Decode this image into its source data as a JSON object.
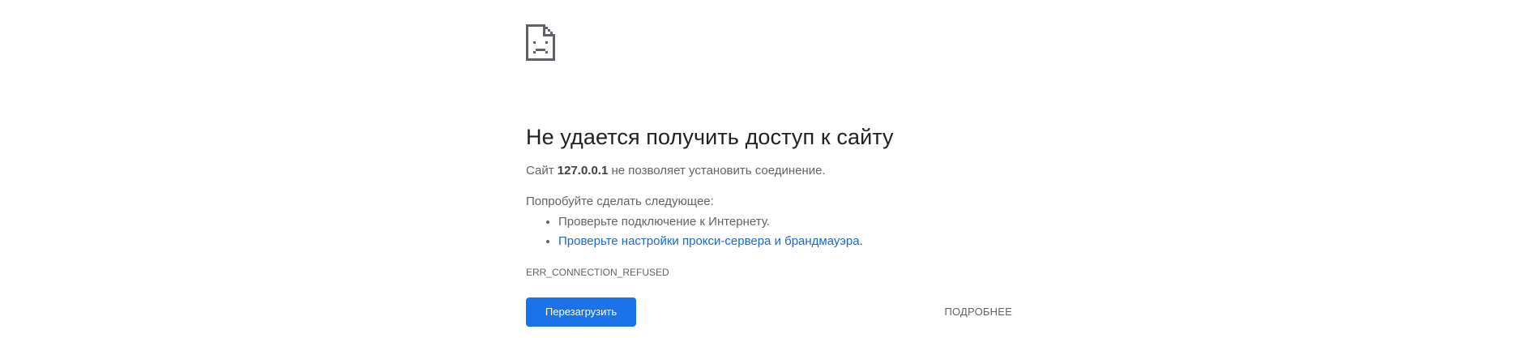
{
  "error_page": {
    "icon": "sad-page-icon",
    "title": "Не удается получить доступ к сайту",
    "summary_prefix": "Сайт ",
    "host": "127.0.0.1",
    "summary_suffix": " не позволяет установить соединение.",
    "suggestions_heading": "Попробуйте сделать следующее:",
    "suggestions": [
      {
        "label": "Проверьте подключение к Интернету.",
        "is_link": false
      },
      {
        "label": "Проверьте настройки прокси-сервера и брандмауэра.",
        "is_link": true
      }
    ],
    "error_code": "ERR_CONNECTION_REFUSED"
  },
  "buttons": {
    "reload_label": "Перезагрузить",
    "details_label": "ПОДРОБНЕЕ"
  },
  "colors": {
    "primary": "#1a73e8",
    "link": "#1967d2",
    "title": "#202124",
    "text": "#5f6368"
  }
}
